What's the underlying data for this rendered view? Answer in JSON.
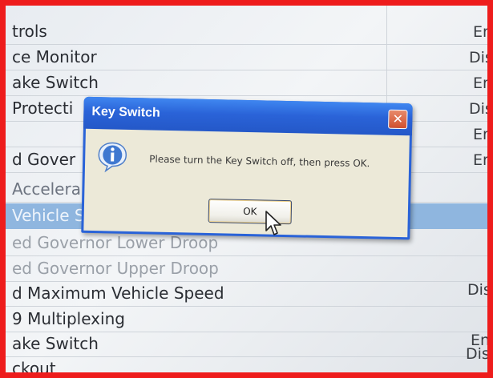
{
  "list": {
    "rows": [
      {
        "name": "trols",
        "value": "En"
      },
      {
        "name": "ce Monitor",
        "value": "Dis"
      },
      {
        "name": "ake Switch",
        "value": "En"
      },
      {
        "name": "Protecti",
        "value": "Dis"
      },
      {
        "name": "",
        "value": "En"
      },
      {
        "name": "d Gover",
        "value": "En"
      },
      {
        "name": "Accelera",
        "value": ""
      },
      {
        "name": "Vehicle S",
        "value": ""
      },
      {
        "name": "ed Governor Lower Droop",
        "value": ""
      },
      {
        "name": "ed Governor Upper Droop",
        "value": ""
      },
      {
        "name": "d Maximum Vehicle Speed",
        "value": "Dis"
      },
      {
        "name": "9 Multiplexing",
        "value": ""
      },
      {
        "name": "ake Switch",
        "value": "En"
      },
      {
        "name": "ckout",
        "value": "Disa"
      }
    ]
  },
  "dialog": {
    "title": "Key Switch",
    "close_symbol": "✕",
    "message": "Please turn the Key Switch off, then press OK.",
    "ok_label": "OK",
    "icon": "info-icon"
  },
  "colors": {
    "frame_border": "#ee1c1c",
    "titlebar": "#2a63d8",
    "selected_row": "#8fb6df",
    "dialog_body": "#ece9d8"
  }
}
